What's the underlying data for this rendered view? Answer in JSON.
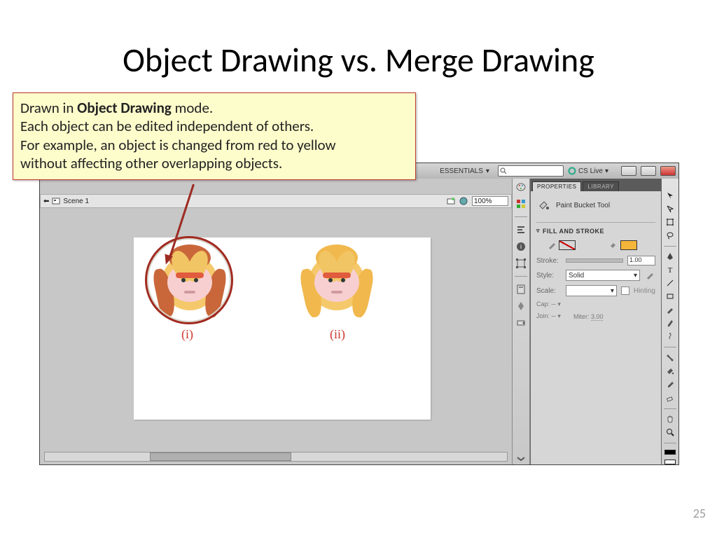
{
  "slide": {
    "title": "Object Drawing vs. Merge Drawing",
    "page_number": "25"
  },
  "callout": {
    "line1_prefix": "Drawn in ",
    "line1_bold": "Object Drawing",
    "line1_suffix": " mode.",
    "line2": "Each object can be edited independent of others.",
    "line3": "For example, an object is changed from red to yellow",
    "line4": "without affecting other overlapping objects."
  },
  "app": {
    "workspace": {
      "label": "ESSENTIALS",
      "chevron": "▾"
    },
    "cs_live": "CS Live",
    "scene": {
      "label": "Scene 1"
    },
    "zoom": "100%",
    "canvas": {
      "caption_i": "(i)",
      "caption_ii": "(ii)"
    },
    "panels": {
      "tab_properties": "PROPERTIES",
      "tab_library": "LIBRARY",
      "tool_name": "Paint Bucket Tool",
      "section_fill_stroke": "FILL AND STROKE",
      "stroke_label": "Stroke:",
      "stroke_value": "1.00",
      "style_label": "Style:",
      "style_value": "Solid",
      "scale_label": "Scale:",
      "scale_value": "",
      "hinting_label": "Hinting",
      "cap_label": "Cap:",
      "join_label": "Join:",
      "miter_label": "Miter:",
      "miter_value": "3.00"
    }
  },
  "icons": {
    "search": "search-icon",
    "cslive": "cslive-ring-icon",
    "bucket": "paint-bucket-icon",
    "pencil": "pencil-icon",
    "chevron": "chevron-down-icon"
  }
}
